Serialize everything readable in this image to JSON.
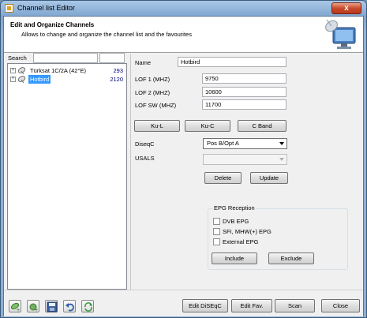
{
  "window": {
    "title": "Channel list Editor",
    "close_label": "x"
  },
  "header": {
    "title": "Edit and Organize Channels",
    "subtitle": "Allows to change and organize the channel list and the favourites"
  },
  "left": {
    "search_label": "Search",
    "search_value": "",
    "search2_value": "",
    "tree": [
      {
        "name": "Türksat 1C/2A (42°E)",
        "value": "293",
        "selected": false
      },
      {
        "name": "Hotbird",
        "value": "2120",
        "selected": true
      }
    ]
  },
  "form": {
    "name_label": "Name",
    "name_value": "Hotbird",
    "lof1_label": "LOF 1 (MHZ)",
    "lof1_value": "9750",
    "lof2_label": "LOF 2 (MHZ)",
    "lof2_value": "10600",
    "lofsw_label": "LOF SW (MHZ)",
    "lofsw_value": "11700",
    "band_buttons": [
      "Ku-L",
      "Ku-C",
      "C Band"
    ],
    "diseqc_label": "DiseqC",
    "diseqc_value": "Pos B/Opt A",
    "usals_label": "USALS",
    "usals_value": "",
    "delete_label": "Delete",
    "update_label": "Update"
  },
  "epg": {
    "title": "EPG Reception",
    "options": [
      {
        "label": "DVB EPG",
        "checked": false
      },
      {
        "label": "SFI, MHW(+) EPG",
        "checked": false
      },
      {
        "label": "External EPG",
        "checked": false
      }
    ],
    "include_label": "Include",
    "exclude_label": "Exclude"
  },
  "bottom": {
    "toolbar_icons": [
      "add-satellite-icon",
      "add-channel-icon",
      "save-icon",
      "undo-icon",
      "refresh-icon"
    ],
    "edit_diseqc_label": "Edit DiSEqC",
    "edit_fav_label": "Edit Fav.",
    "scan_label": "Scan",
    "close_label": "Close"
  },
  "colors": {
    "selection": "#3399ff",
    "value_text": "#000080",
    "close_button": "#c94a2a"
  }
}
